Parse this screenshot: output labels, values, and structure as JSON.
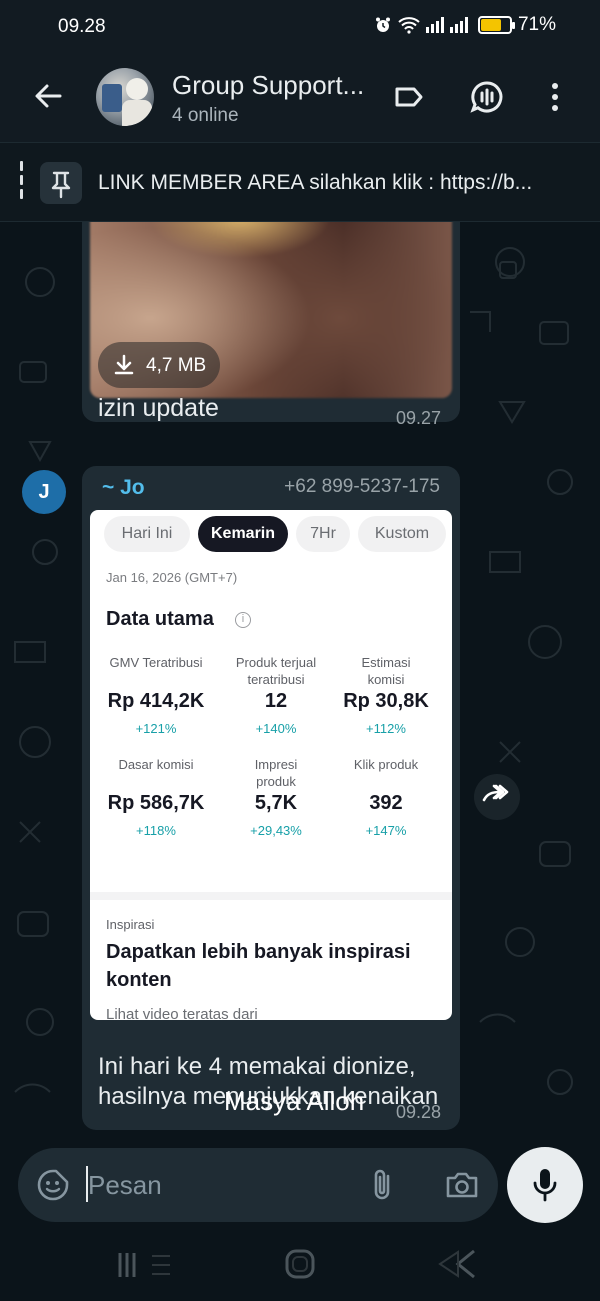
{
  "status_bar": {
    "time": "09.28",
    "battery": "71%",
    "battery_level": 0.71
  },
  "header": {
    "title": "Group Support...",
    "subtitle": "4 online"
  },
  "pinned": {
    "text": "LINK MEMBER AREA silahkan klik  : https://b..."
  },
  "messages": [
    {
      "type": "image",
      "file_size": "4,7 MB",
      "caption": "izin update",
      "time": "09.27"
    },
    {
      "type": "image",
      "avatar_letter": "J",
      "sender": "~ Jo",
      "phone": "+62 899-5237-175",
      "text": "Ini hari ke 4 memakai dionize, hasilnya menunjukkan kenaikan",
      "time": "09.28"
    }
  ],
  "screenshot": {
    "tabs": [
      "Hari Ini",
      "Kemarin",
      "7Hr",
      "Kustom"
    ],
    "active_tab": "Kemarin",
    "date": "Jan 16, 2026 (GMT+7)",
    "section_title": "Data utama",
    "metrics": [
      {
        "label": "GMV Teratribusi",
        "value": "Rp 414,2K",
        "change": "+121%"
      },
      {
        "label": "Produk terjual teratribusi",
        "value": "12",
        "change": "+140%"
      },
      {
        "label": "Estimasi komisi",
        "value": "Rp 30,8K",
        "change": "+112%"
      },
      {
        "label": "Dasar komisi",
        "value": "Rp 586,7K",
        "change": "+118%"
      },
      {
        "label": "Impresi produk",
        "value": "5,7K",
        "change": "+29,43%"
      },
      {
        "label": "Klik produk",
        "value": "392",
        "change": "+147%"
      }
    ],
    "inspiration_label": "Inspirasi",
    "inspiration_title": "Dapatkan lebih banyak inspirasi konten",
    "inspiration_sub": "Lihat video teratas dari"
  },
  "overlay_text": "Masya Alloh",
  "input": {
    "placeholder": "Pesan"
  },
  "colors": {
    "accent": "#53bdeb",
    "bubble": "#1f2c34",
    "background": "#0b141a",
    "change": "#18a0a8"
  }
}
